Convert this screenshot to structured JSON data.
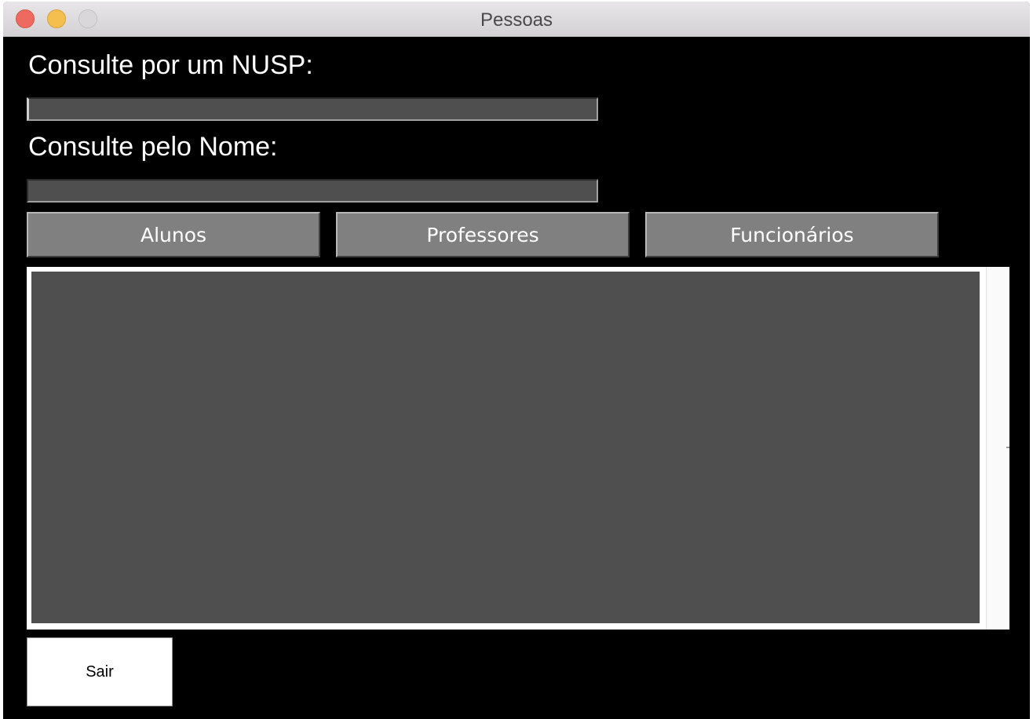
{
  "window": {
    "title": "Pessoas"
  },
  "search": {
    "nusp_label": "Consulte por um NUSP:",
    "nusp_value": "",
    "nome_label": "Consulte pelo Nome:",
    "nome_value": ""
  },
  "buttons": {
    "alunos": "Alunos",
    "professores": "Professores",
    "funcionarios": "Funcionários",
    "sair": "Sair"
  },
  "results": {
    "items": []
  },
  "colors": {
    "background": "#000000",
    "field": "#4f4f4f",
    "button": "#808080",
    "close": "#ee6a5e",
    "minimize": "#f5bf4f"
  }
}
